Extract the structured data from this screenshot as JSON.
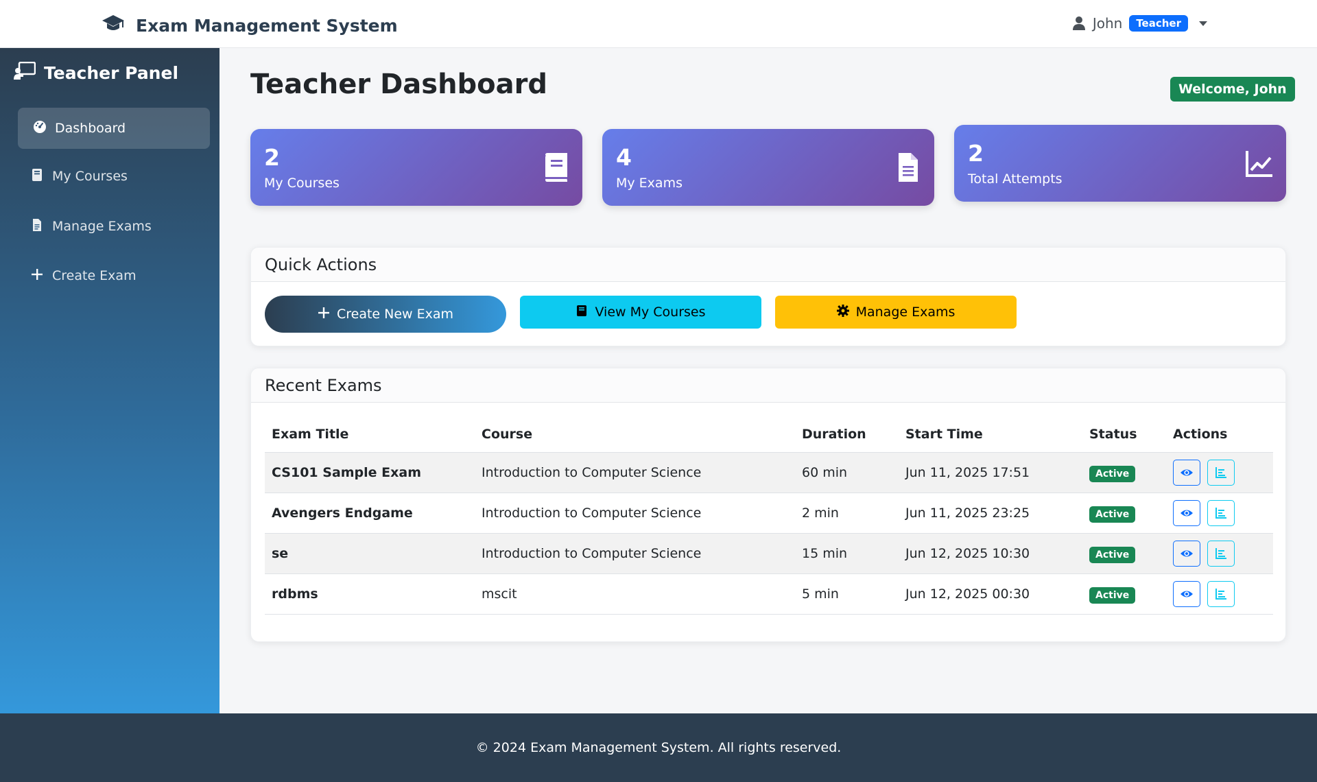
{
  "navbar": {
    "brand": "Exam Management System",
    "user_name": "John",
    "role_badge": "Teacher"
  },
  "sidebar": {
    "title": "Teacher Panel",
    "items": [
      {
        "label": "Dashboard",
        "icon": "gauge-icon",
        "active": true
      },
      {
        "label": "My Courses",
        "icon": "book-icon"
      },
      {
        "label": "Manage Exams",
        "icon": "file-icon"
      },
      {
        "label": "Create Exam",
        "icon": "plus-icon"
      }
    ]
  },
  "main": {
    "title": "Teacher Dashboard",
    "welcome": "Welcome, John"
  },
  "stats": [
    {
      "value": "2",
      "label": "My Courses",
      "icon": "book-icon"
    },
    {
      "value": "4",
      "label": "My Exams",
      "icon": "file-text-icon"
    },
    {
      "value": "2",
      "label": "Total Attempts",
      "icon": "chart-line-icon"
    }
  ],
  "quick_actions": {
    "title": "Quick Actions",
    "buttons": [
      {
        "label": "Create New Exam",
        "icon": "plus-icon"
      },
      {
        "label": "View My Courses",
        "icon": "book-icon"
      },
      {
        "label": "Manage Exams",
        "icon": "gear-icon"
      }
    ]
  },
  "recent_exams": {
    "title": "Recent Exams",
    "columns": [
      "Exam Title",
      "Course",
      "Duration",
      "Start Time",
      "Status",
      "Actions"
    ],
    "rows": [
      {
        "title": "CS101 Sample Exam",
        "course": "Introduction to Computer Science",
        "duration": "60 min",
        "start": "Jun 11, 2025 17:51",
        "status": "Active"
      },
      {
        "title": "Avengers Endgame",
        "course": "Introduction to Computer Science",
        "duration": "2 min",
        "start": "Jun 11, 2025 23:25",
        "status": "Active"
      },
      {
        "title": "se",
        "course": "Introduction to Computer Science",
        "duration": "15 min",
        "start": "Jun 12, 2025 10:30",
        "status": "Active"
      },
      {
        "title": "rdbms",
        "course": "mscit",
        "duration": "5 min",
        "start": "Jun 12, 2025 00:30",
        "status": "Active"
      }
    ]
  },
  "footer": {
    "text": "© 2024 Exam Management System. All rights reserved."
  },
  "colors": {
    "sidebar_top": "#2c3e50",
    "sidebar_bottom": "#3498db",
    "stat_gradient_start": "#667eea",
    "stat_gradient_end": "#764ba2",
    "success": "#198754",
    "info": "#0dcaf0",
    "warning": "#ffc107",
    "primary": "#0d6efd"
  }
}
